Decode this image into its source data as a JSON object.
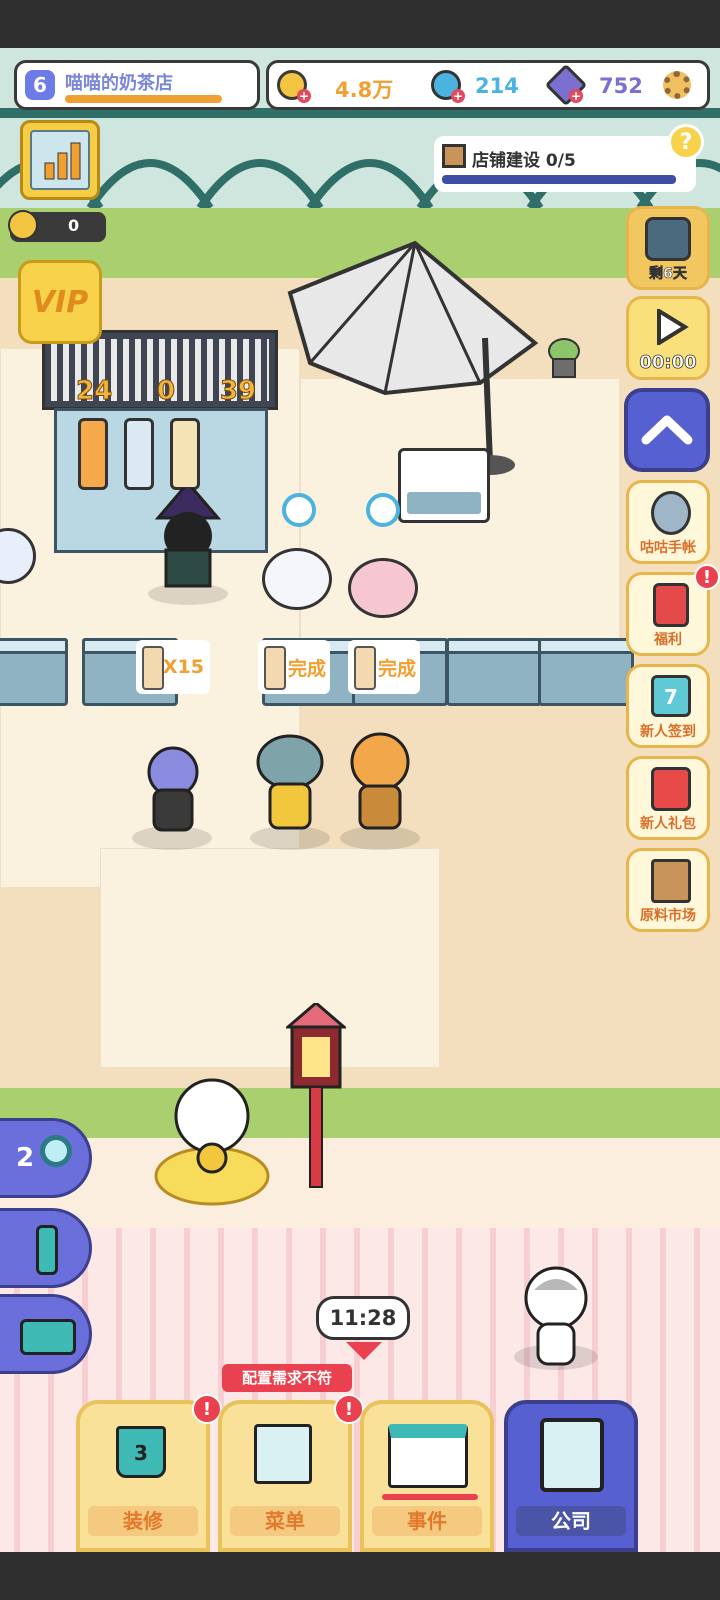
{
  "header": {
    "level": "6",
    "shop_name": "喵喵的奶茶店",
    "level_progress_pct": 88,
    "coins": "4.8万",
    "gems_blue": "214",
    "gems_purple": "752"
  },
  "construction": {
    "label": "店铺建设 0/5",
    "progress_pct": 0
  },
  "left_panel": {
    "boost_value": "0",
    "vip_label": "VIP"
  },
  "machine_counts": [
    "24",
    "0",
    "39"
  ],
  "right_menu": {
    "timed_event_label": "剩6天",
    "video_timer": "00:00",
    "items": [
      {
        "label": "咕咕手帐",
        "badge": false
      },
      {
        "label": "福利",
        "badge": true
      },
      {
        "label": "新人签到",
        "badge": false,
        "calendar_day": "7"
      },
      {
        "label": "新人礼包",
        "badge": false
      },
      {
        "label": "原料市场",
        "badge": false
      }
    ]
  },
  "orders": [
    {
      "text": "X15"
    },
    {
      "text": "完成"
    },
    {
      "text": "完成"
    }
  ],
  "left_tools": {
    "search_count": "2"
  },
  "clock": "11:28",
  "warning": "配置需求不符",
  "bottom_nav": [
    {
      "label": "装修",
      "badge": true,
      "count": "3"
    },
    {
      "label": "菜单",
      "badge": true
    },
    {
      "label": "事件",
      "badge": false
    },
    {
      "label": "公司",
      "badge": false,
      "active": true
    }
  ],
  "colors": {
    "accent_orange": "#f0a030",
    "accent_blue": "#4bb3e0",
    "accent_purple": "#7b6fcf",
    "badge_red": "#e9414f",
    "nav_active": "#5660d0"
  }
}
